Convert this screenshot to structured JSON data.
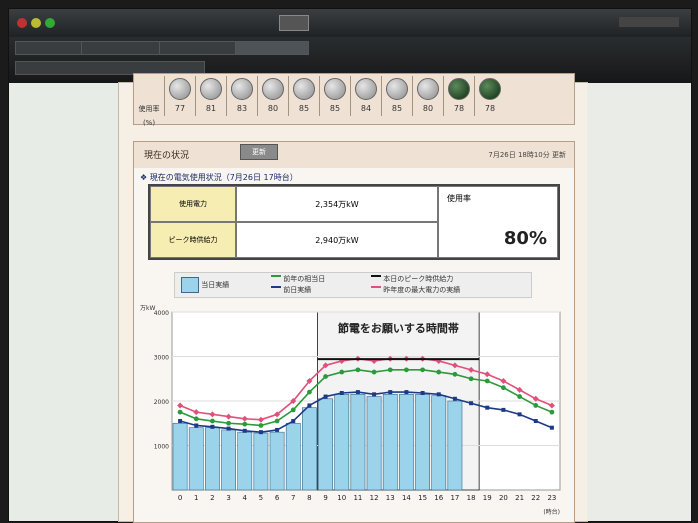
{
  "browser": {
    "tabs": [
      "",
      "",
      "",
      "",
      ""
    ]
  },
  "usage_table": {
    "row_label": "使用率(%)",
    "values": [
      "77",
      "81",
      "83",
      "80",
      "85",
      "85",
      "84",
      "85",
      "80",
      "78",
      "78"
    ]
  },
  "status": {
    "section_title": "現在の状況",
    "update_button": "更新",
    "updated_stamp": "7月26日 18時10分 更新",
    "usage_subtitle": "現在の電気使用状況（7月26日 17時台）",
    "used_label": "使用電力",
    "used_value": "2,354万kW",
    "peak_label": "ピーク時供給力",
    "peak_value": "2,940万kW",
    "rate_label": "使用率",
    "rate_value": "80%"
  },
  "legend": {
    "today": "当日実績",
    "last_year_same": "前年の相当日",
    "prev_day": "前日実績",
    "peak_supply_today": "本日のピーク時供給力",
    "last_year_max": "昨年度の最大電力の実績"
  },
  "chart_data": {
    "type": "bar",
    "title": "節電をお願いする時間帯",
    "ylabel": "万kW",
    "xlabel": "(時台)",
    "ylim": [
      0,
      4000
    ],
    "yticks": [
      "1000",
      "2000",
      "3000",
      "4000"
    ],
    "categories": [
      "0",
      "1",
      "2",
      "3",
      "4",
      "5",
      "6",
      "7",
      "8",
      "9",
      "10",
      "11",
      "12",
      "13",
      "14",
      "15",
      "16",
      "17",
      "18",
      "19",
      "20",
      "21",
      "22",
      "23"
    ],
    "series": [
      {
        "name": "当日実績",
        "kind": "bar",
        "color": "#9bd3ea",
        "values": [
          1500,
          1400,
          1400,
          1350,
          1300,
          1280,
          1300,
          1500,
          1850,
          2050,
          2150,
          2150,
          2100,
          2150,
          2150,
          2150,
          2120,
          2000,
          null,
          null,
          null,
          null,
          null,
          null
        ]
      },
      {
        "name": "前日実績",
        "kind": "line",
        "color": "#1d3a8a",
        "values": [
          1550,
          1450,
          1420,
          1380,
          1330,
          1300,
          1350,
          1550,
          1900,
          2100,
          2180,
          2200,
          2150,
          2200,
          2200,
          2180,
          2150,
          2050,
          1950,
          1850,
          1800,
          1700,
          1550,
          1400
        ]
      },
      {
        "name": "前年の相当日",
        "kind": "line",
        "color": "#2a9a3a",
        "values": [
          1750,
          1600,
          1550,
          1500,
          1480,
          1450,
          1550,
          1800,
          2200,
          2550,
          2650,
          2700,
          2650,
          2700,
          2700,
          2700,
          2650,
          2600,
          2500,
          2450,
          2300,
          2100,
          1900,
          1750
        ]
      },
      {
        "name": "昨年度の最大電力の実績",
        "kind": "line",
        "color": "#e0507a",
        "values": [
          1900,
          1750,
          1700,
          1650,
          1600,
          1580,
          1700,
          2000,
          2450,
          2800,
          2900,
          2950,
          2900,
          2950,
          2950,
          2950,
          2900,
          2800,
          2700,
          2600,
          2450,
          2250,
          2050,
          1900
        ]
      },
      {
        "name": "本日のピーク時供給力",
        "kind": "segment",
        "color": "#111111",
        "values": [
          null,
          null,
          null,
          null,
          null,
          null,
          null,
          null,
          null,
          2940,
          2940,
          2940,
          2940,
          2940,
          2940,
          2940,
          2940,
          2940,
          2940,
          null,
          null,
          null,
          null,
          null
        ]
      }
    ],
    "shaded_range": [
      9,
      19
    ],
    "grid": true
  }
}
